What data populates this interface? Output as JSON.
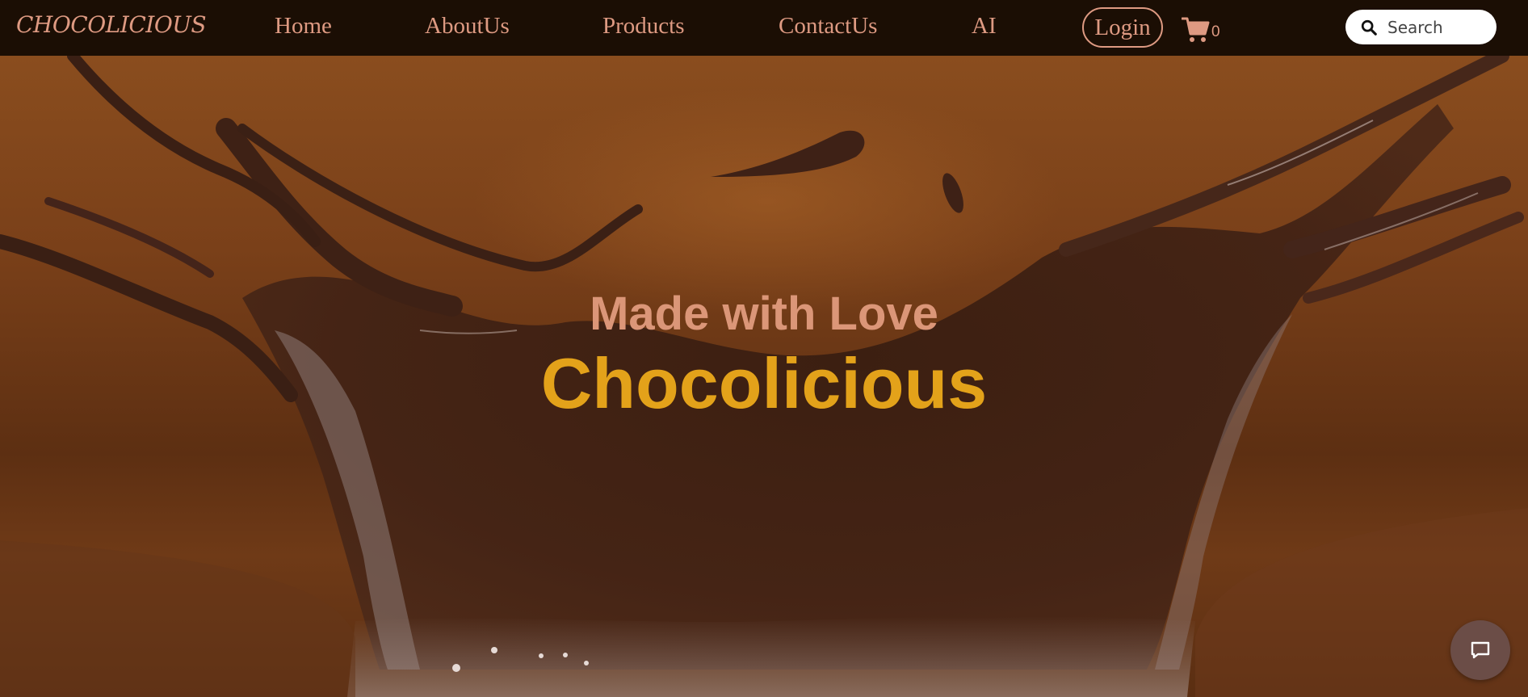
{
  "nav": {
    "brand": "CHOCOLICIOUS",
    "links": [
      "Home",
      "AboutUs",
      "Products",
      "ContactUs",
      "AI"
    ],
    "login_label": "Login",
    "cart_count": "0",
    "cart_icon": "shopping-cart-icon",
    "search": {
      "placeholder": "Search",
      "icon": "search-icon"
    }
  },
  "hero": {
    "subtitle": "Made with Love",
    "title": "Chocolicious"
  },
  "chat": {
    "icon": "chat-icon"
  },
  "colors": {
    "nav_background": "#1b0e04",
    "nav_text": "#de9a82",
    "hero_subtitle": "#db9678",
    "hero_title": "#e3a21a",
    "chat_button": "#6b4d47"
  }
}
